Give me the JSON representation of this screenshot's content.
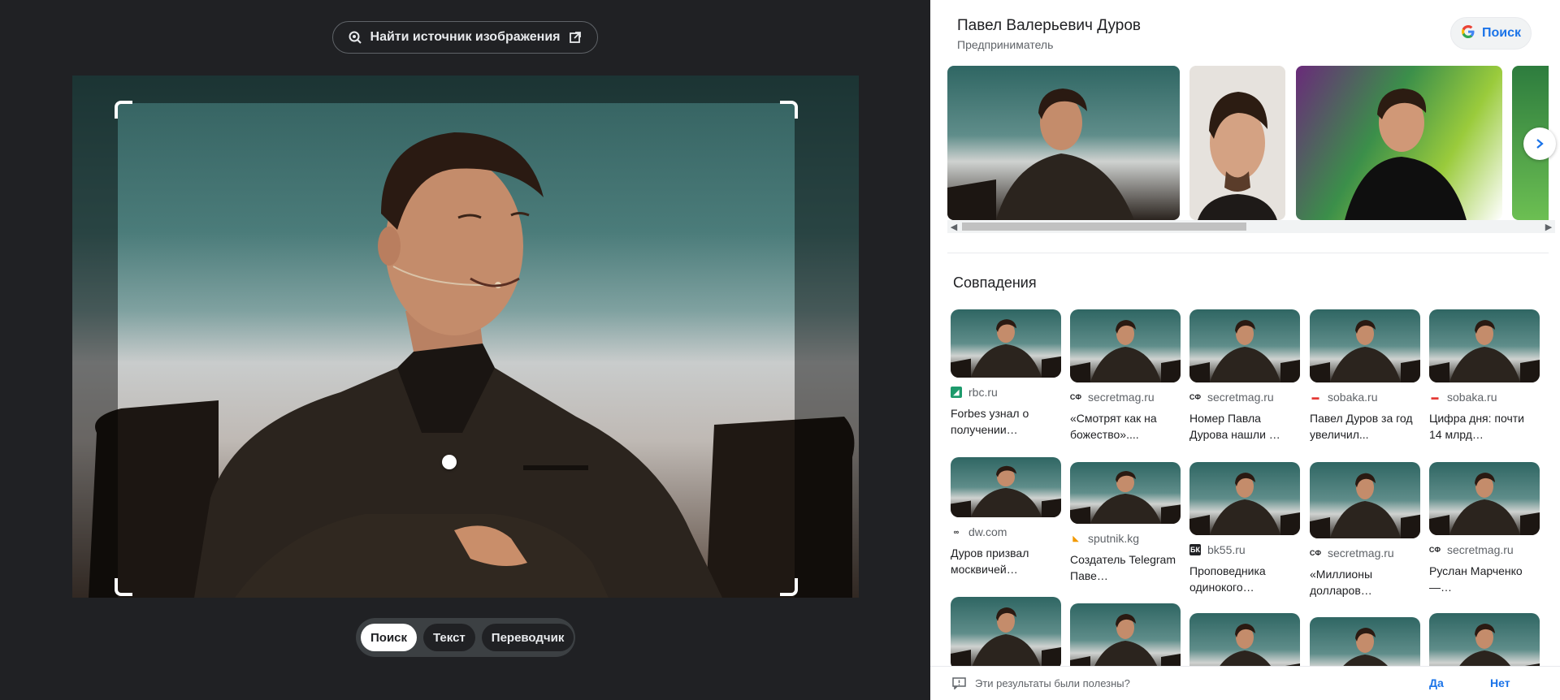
{
  "lens": {
    "find_source_label": "Найти источник изображения",
    "modes": [
      "Поиск",
      "Текст",
      "Переводчик"
    ],
    "active_mode": 0
  },
  "knowledge": {
    "title": "Павел Валерьевич Дуров",
    "subtitle": "Предприниматель",
    "search_label": "Поиск"
  },
  "matches": {
    "title": "Совпадения",
    "items": [
      {
        "source": "rbc.ru",
        "caption": "Forbes узнал о получении…",
        "favicon_color": "#1d9a6c"
      },
      {
        "source": "secretmag.ru",
        "caption": "«Смотрят как на божество»....",
        "favicon_color": "#202124"
      },
      {
        "source": "secretmag.ru",
        "caption": "Номер Павла Дурова нашли …",
        "favicon_color": "#202124"
      },
      {
        "source": "sobaka.ru",
        "caption": "Павел Дуров за год увеличил...",
        "favicon_color": "#e53935"
      },
      {
        "source": "sobaka.ru",
        "caption": "Цифра дня: почти 14 млрд…",
        "favicon_color": "#e53935"
      },
      {
        "source": "dw.com",
        "caption": "Дуров призвал москвичей…",
        "favicon_color": "#202124"
      },
      {
        "source": "sputnik.kg",
        "caption": "Создатель Telegram Паве…",
        "favicon_color": "#f29900"
      },
      {
        "source": "bk55.ru",
        "caption": "Проповедника одинокого…",
        "favicon_color": "#202124"
      },
      {
        "source": "secretmag.ru",
        "caption": "«Миллионы долларов…",
        "favicon_color": "#202124"
      },
      {
        "source": "secretmag.ru",
        "caption": "Руслан Марченко —…",
        "favicon_color": "#202124"
      }
    ]
  },
  "feedback": {
    "question": "Эти результаты были полезны?",
    "yes": "Да",
    "no": "Нет"
  },
  "colors": {
    "accent": "#1a73e8",
    "dark_bg": "#202124"
  }
}
